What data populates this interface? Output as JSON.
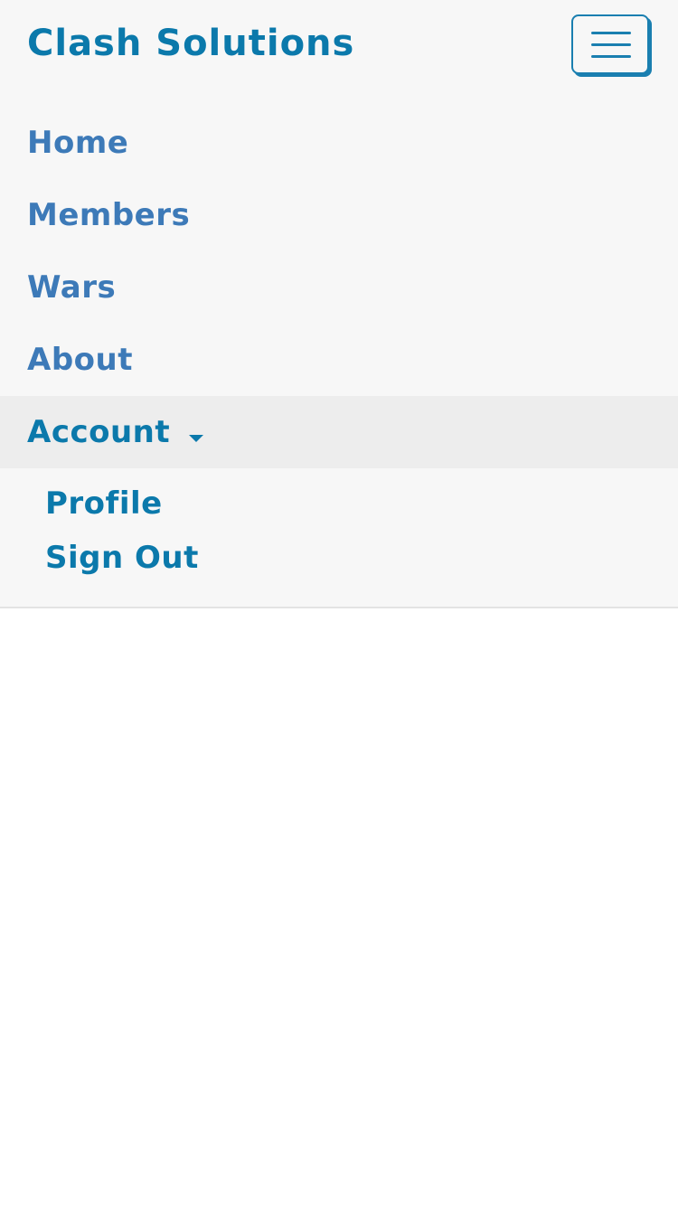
{
  "colors": {
    "brand": "#0b79ab",
    "link": "#3d7ab8",
    "active_link": "#0b79ab",
    "navbar_bg": "#f7f7f7",
    "active_bg": "#ededed",
    "page_bg": "#ffffff"
  },
  "navbar": {
    "brand": "Clash Solutions",
    "toggle_icon": "hamburger-menu-icon",
    "items": [
      {
        "label": "Home"
      },
      {
        "label": "Members"
      },
      {
        "label": "Wars"
      },
      {
        "label": "About"
      },
      {
        "label": "Account",
        "icon": "caret-down-icon"
      }
    ],
    "account_dropdown": [
      {
        "label": "Profile"
      },
      {
        "label": "Sign Out"
      }
    ]
  }
}
